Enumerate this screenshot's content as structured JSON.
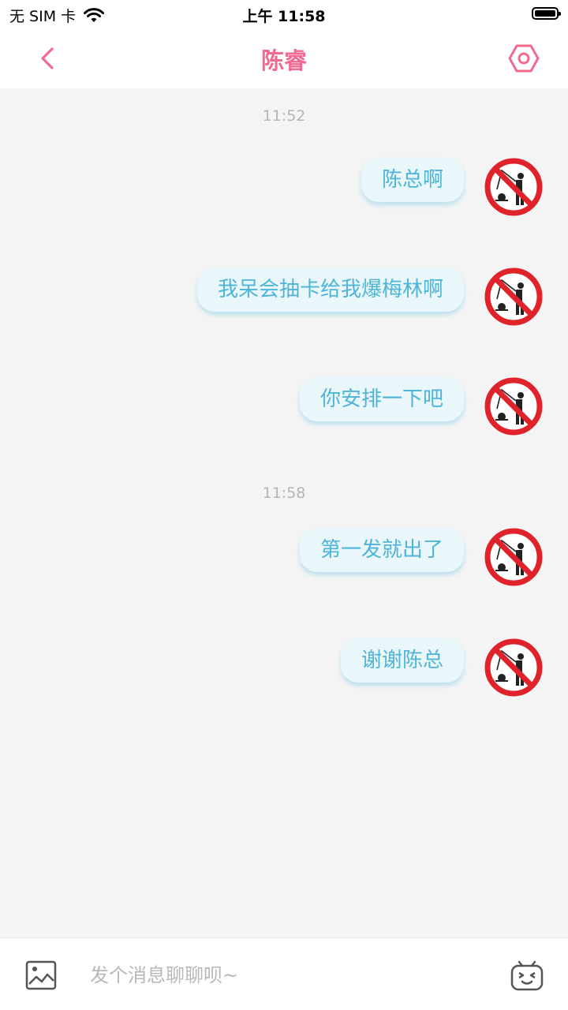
{
  "status_bar": {
    "carrier": "无 SIM 卡",
    "time": "上午 11:58",
    "icons": [
      "wifi-icon",
      "battery-icon"
    ]
  },
  "nav": {
    "title": "陈睿",
    "back_icon": "chevron-left-icon",
    "settings_icon": "settings-hexagon-icon",
    "accent_color": "#f06b8f"
  },
  "chat": {
    "timestamps": [
      "11:52",
      "11:58"
    ],
    "messages": [
      {
        "text": "陈总啊",
        "sender": "self",
        "avatar": "no-fishing-sign-avatar"
      },
      {
        "text": "我呆会抽卡给我爆梅林啊",
        "sender": "self",
        "avatar": "no-fishing-sign-avatar"
      },
      {
        "text": "你安排一下吧",
        "sender": "self",
        "avatar": "no-fishing-sign-avatar"
      },
      {
        "text": "第一发就出了",
        "sender": "self",
        "avatar": "no-fishing-sign-avatar"
      },
      {
        "text": "谢谢陈总",
        "sender": "self",
        "avatar": "no-fishing-sign-avatar"
      }
    ],
    "bubble_color": "#e9f7fb",
    "bubble_text_color": "#4fb5d8"
  },
  "input_bar": {
    "placeholder": "发个消息聊聊呗~",
    "image_icon": "image-icon",
    "emoji_icon": "emoji-face-icon"
  }
}
